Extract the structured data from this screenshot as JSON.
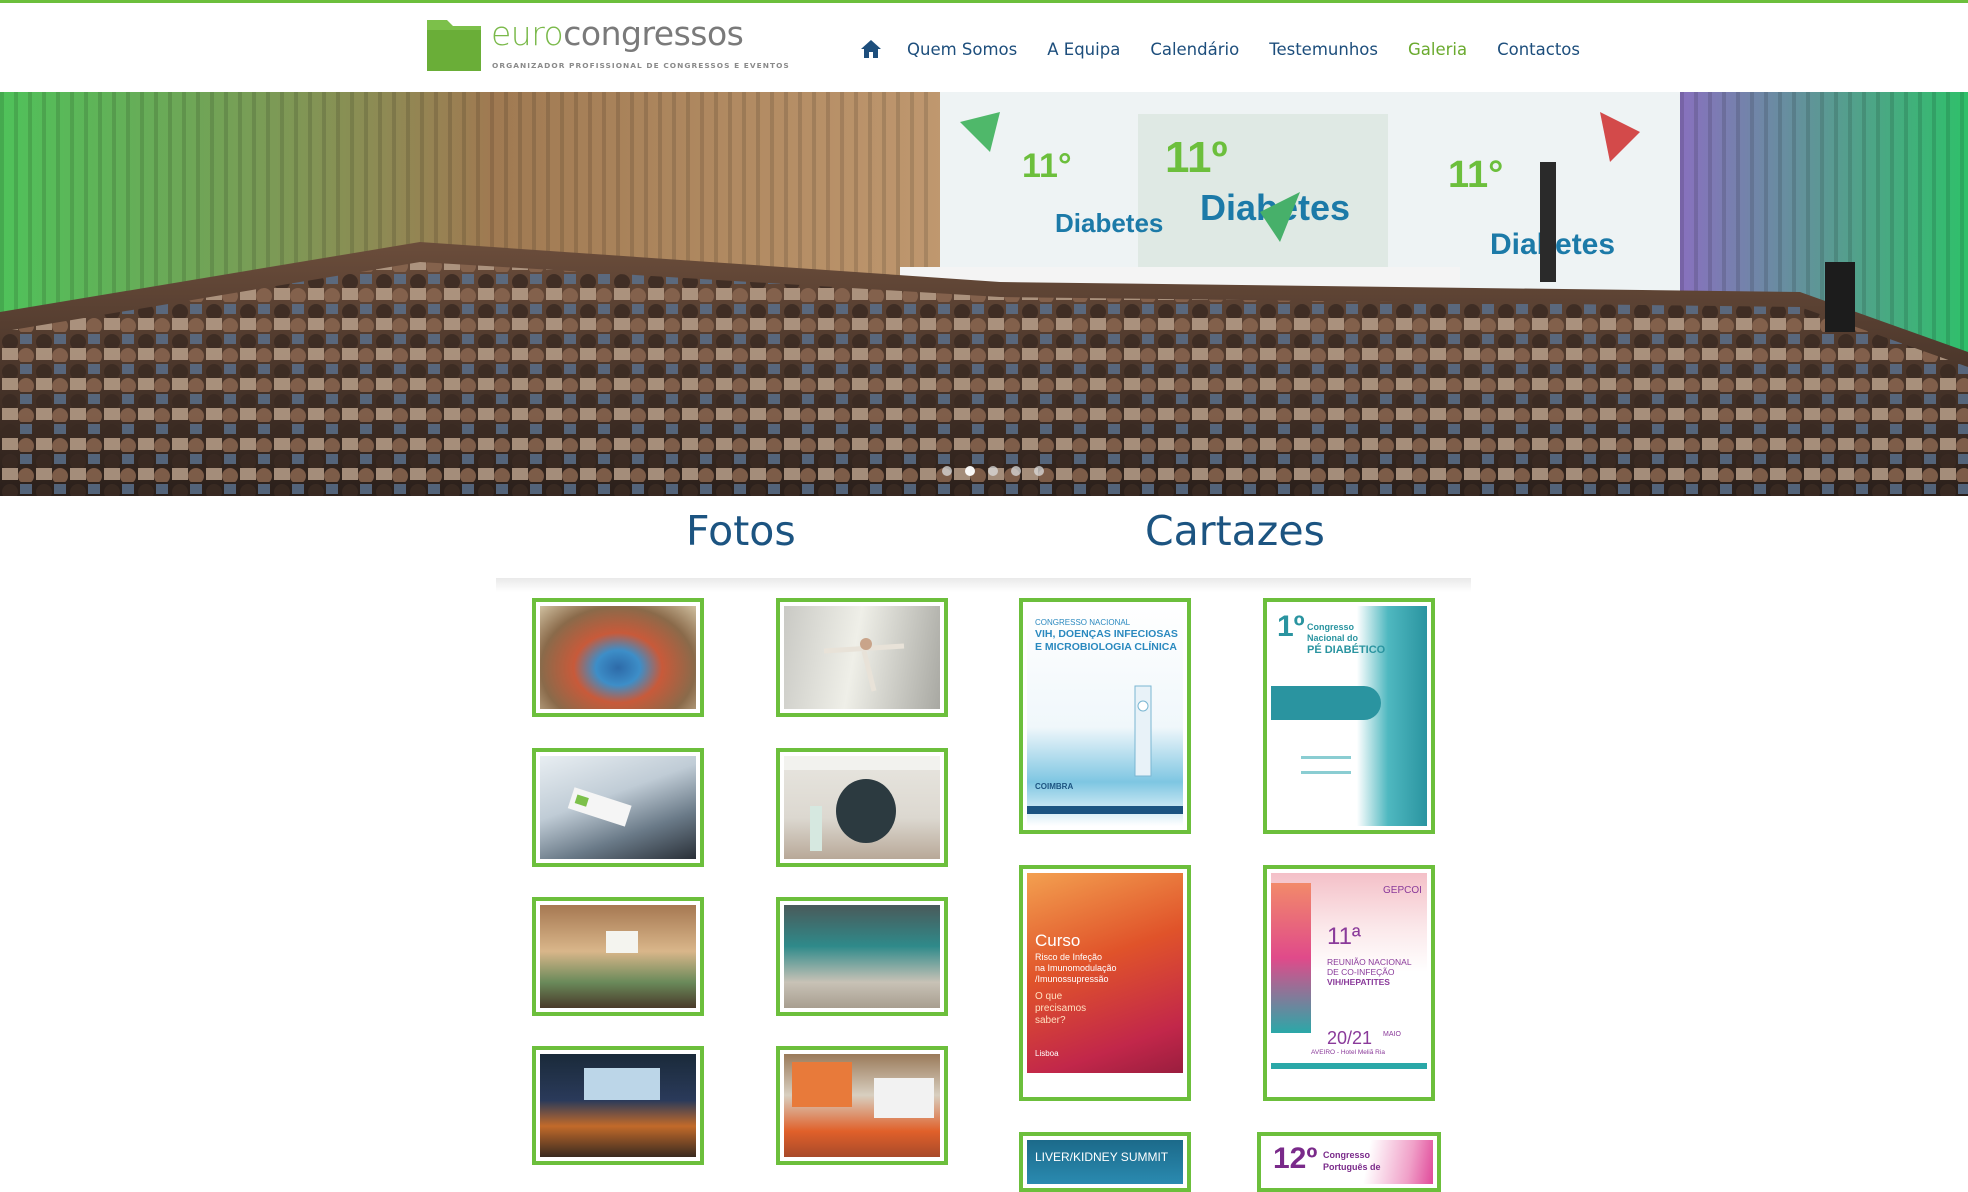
{
  "brand": {
    "name_part1": "euro",
    "name_part2": "congressos",
    "tagline": "ORGANIZADOR PROFISSIONAL DE CONGRESSOS E EVENTOS",
    "accent": "#6cbf3c",
    "navy": "#1c5481"
  },
  "nav": {
    "home_icon": "home-icon",
    "items": [
      "Quem Somos",
      "A Equipa",
      "Calendário",
      "Testemunhos",
      "Galeria",
      "Contactos"
    ],
    "active": "Galeria"
  },
  "hero": {
    "banner_lines": [
      "11º",
      "Diabetes"
    ],
    "slides": 5,
    "active_slide": 2
  },
  "sections": {
    "fotos_title": "Fotos",
    "cartazes_title": "Cartazes"
  },
  "fotos": [
    "congress-hall-photo",
    "dancer-photo",
    "bus-photo",
    "forum-diabetes-photo",
    "auditorium-photo",
    "exhibition-stand-photo",
    "seated-audience-photo",
    "insulinoterapia-photo"
  ],
  "cartazes": {
    "poster1": {
      "line1": "CONGRESSO NACIONAL",
      "line2": "VIH, DOENÇAS INFECIOSAS",
      "line3": "E MICROBIOLOGIA CLÍNICA",
      "place": "COIMBRA"
    },
    "poster2": {
      "num": "1º",
      "line1": "Congresso",
      "line2": "Nacional do",
      "line3": "PÉ DIABÉTICO"
    },
    "poster3": {
      "line1": "Curso",
      "line2": "Risco de Infeção",
      "line3": "na Imunomodulação",
      "line4": "/Imunossupressão",
      "line5": "O que",
      "line6": "precisamos",
      "line7": "saber?",
      "city": "Lisboa"
    },
    "poster4": {
      "brand": "GEPCOI",
      "num": "11ª",
      "line1": "REUNIÃO NACIONAL",
      "line2": "DE CO-INFEÇÃO",
      "line3": "VIH/HEPATITES",
      "dates": "20/21",
      "month": "MAIO",
      "place": "AVEIRO - Hotel Meliã Ria"
    },
    "poster5": {
      "line1": "LIVER/KIDNEY SUMMIT"
    },
    "poster6": {
      "num": "12º",
      "line1": "Congresso",
      "line2": "Português de"
    }
  }
}
